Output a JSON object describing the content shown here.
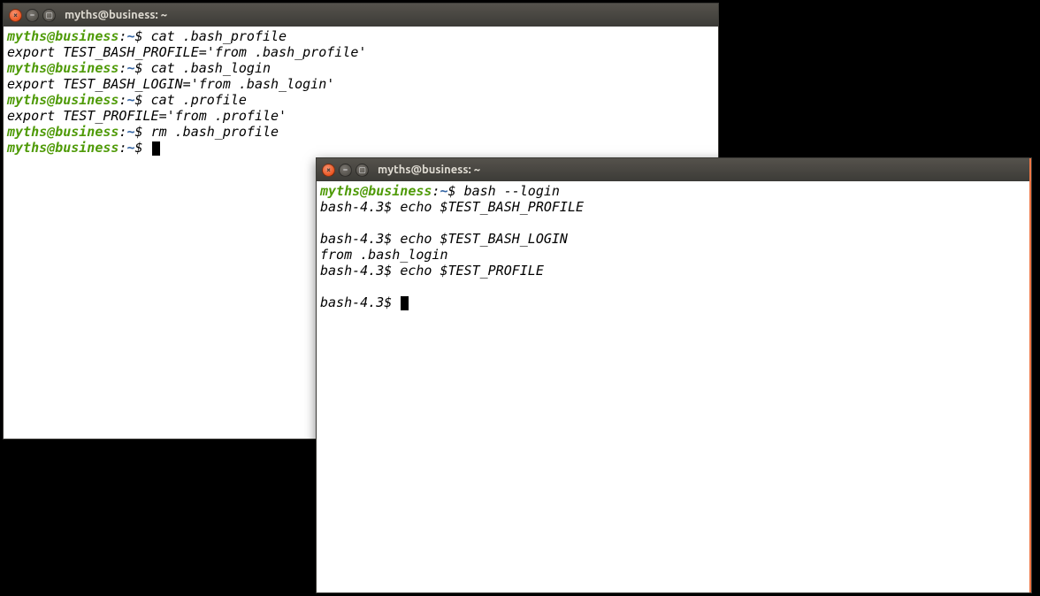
{
  "window1": {
    "title": "myths@business: ~",
    "prompt_user": "myths@business",
    "prompt_sep": ":",
    "prompt_path": "~",
    "prompt_dollar": "$",
    "lines": [
      {
        "type": "prompt",
        "cmd": "cat .bash_profile"
      },
      {
        "type": "out",
        "text": "export TEST_BASH_PROFILE='from .bash_profile'"
      },
      {
        "type": "prompt",
        "cmd": "cat .bash_login"
      },
      {
        "type": "out",
        "text": "export TEST_BASH_LOGIN='from .bash_login'"
      },
      {
        "type": "prompt",
        "cmd": "cat .profile"
      },
      {
        "type": "out",
        "text": "export TEST_PROFILE='from .profile'"
      },
      {
        "type": "prompt",
        "cmd": "rm .bash_profile"
      },
      {
        "type": "prompt",
        "cmd": "",
        "cursor": true
      }
    ]
  },
  "window2": {
    "title": "myths@business: ~",
    "prompt_user": "myths@business",
    "prompt_sep": ":",
    "prompt_path": "~",
    "prompt_dollar": "$",
    "subprompt": "bash-4.3$",
    "lines": [
      {
        "type": "prompt",
        "cmd": "bash --login"
      },
      {
        "type": "sub",
        "cmd": "echo $TEST_BASH_PROFILE"
      },
      {
        "type": "blank"
      },
      {
        "type": "sub",
        "cmd": "echo $TEST_BASH_LOGIN"
      },
      {
        "type": "out",
        "text": "from .bash_login"
      },
      {
        "type": "sub",
        "cmd": "echo $TEST_PROFILE"
      },
      {
        "type": "blank"
      },
      {
        "type": "sub",
        "cmd": "",
        "cursor": true
      }
    ]
  },
  "icons": {
    "close": "×",
    "min": "–",
    "max": "▢"
  }
}
